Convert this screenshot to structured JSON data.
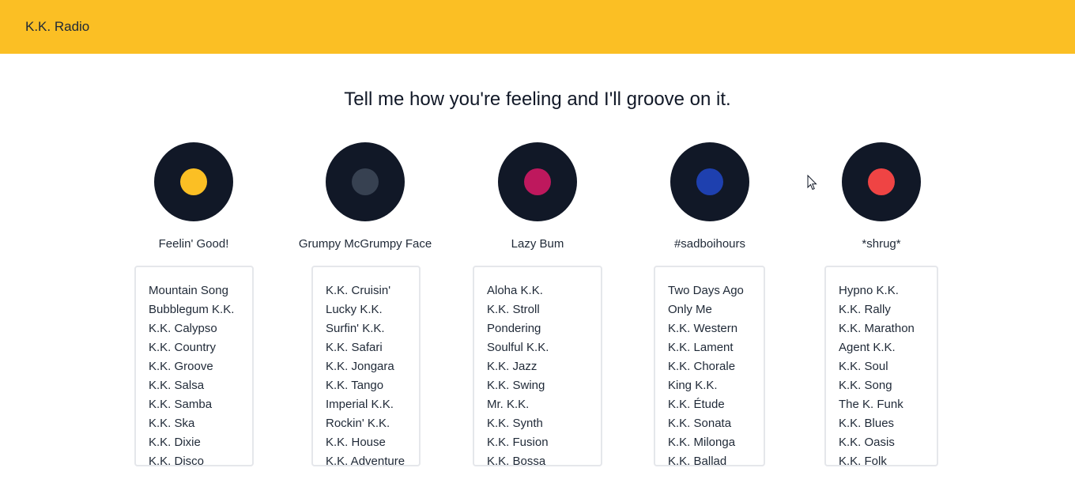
{
  "app": {
    "title": "K.K. Radio"
  },
  "headline": "Tell me how you're feeling and I'll groove on it.",
  "moods": [
    {
      "label": "Feelin' Good!",
      "color": "#fbbf24",
      "songs": [
        "Mountain Song",
        "Bubblegum K.K.",
        "K.K. Calypso",
        "K.K. Country",
        "K.K. Groove",
        "K.K. Salsa",
        "K.K. Samba",
        "K.K. Ska",
        "K.K. Dixie",
        "K.K. Disco"
      ]
    },
    {
      "label": "Grumpy McGrumpy Face",
      "color": "#374151",
      "songs": [
        "K.K. Cruisin'",
        "Lucky K.K.",
        "Surfin' K.K.",
        "K.K. Safari",
        "K.K. Jongara",
        "K.K. Tango",
        "Imperial K.K.",
        "Rockin' K.K.",
        "K.K. House",
        "K.K. Adventure"
      ]
    },
    {
      "label": "Lazy Bum",
      "color": "#be185d",
      "songs": [
        "Aloha K.K.",
        "K.K. Stroll",
        "Pondering",
        "Soulful K.K.",
        "K.K. Jazz",
        "K.K. Swing",
        "Mr. K.K.",
        "K.K. Synth",
        "K.K. Fusion",
        "K.K. Bossa"
      ]
    },
    {
      "label": "#sadboihours",
      "color": "#1e40af",
      "songs": [
        "Two Days Ago",
        "Only Me",
        "K.K. Western",
        "K.K. Lament",
        "K.K. Chorale",
        "King K.K.",
        "K.K. Étude",
        "K.K. Sonata",
        "K.K. Milonga",
        "K.K. Ballad"
      ]
    },
    {
      "label": "*shrug*",
      "color": "#ef4444",
      "songs": [
        "Hypno K.K.",
        "K.K. Rally",
        "K.K. Marathon",
        "Agent K.K.",
        "K.K. Soul",
        "K.K. Song",
        "The K. Funk",
        "K.K. Blues",
        "K.K. Oasis",
        "K.K. Folk"
      ]
    }
  ]
}
